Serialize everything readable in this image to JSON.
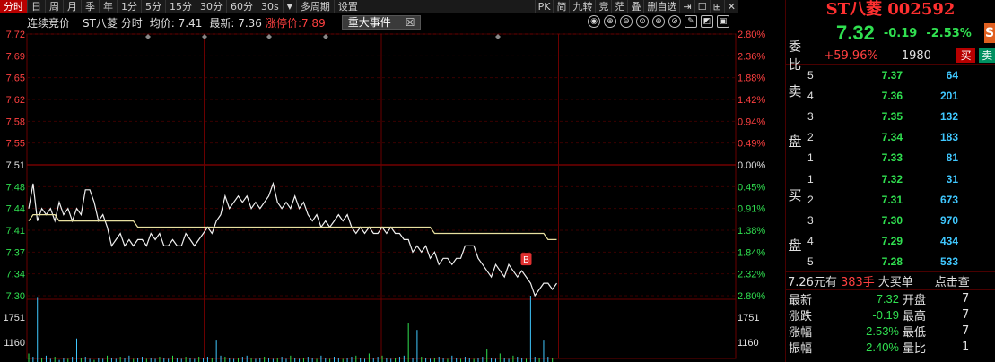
{
  "toolbar": {
    "periods": [
      "分时",
      "日",
      "周",
      "月",
      "季",
      "年",
      "1分",
      "5分",
      "15分",
      "30分",
      "60分",
      "30s",
      "多周期",
      "设置"
    ],
    "active_index": 0,
    "dropdown_arrow": "▼",
    "right_items": [
      "PK",
      "简",
      "九转",
      "竞",
      "茫",
      "叠",
      "删自选",
      "⇥",
      "☐",
      "⊞",
      "✕"
    ]
  },
  "infobar": {
    "continuous_label": "连续竞价",
    "stock_name": "ST八菱 分时",
    "avg_price": "均价: 7.41",
    "latest": "最新: 7.36",
    "limit_up": "涨停价:7.89",
    "event_tag": "重大事件",
    "event_close": "☒",
    "icons": [
      "◉",
      "⊕",
      "⊖",
      "⊙",
      "⊕",
      "⊘",
      "✎",
      "◩",
      "▣"
    ]
  },
  "chart_data": {
    "type": "line",
    "title": "ST八菱 分时",
    "prev_close": 7.51,
    "ylim": [
      7.3,
      7.72
    ],
    "y_ticks": [
      "7.72",
      "7.69",
      "7.65",
      "7.62",
      "7.58",
      "7.55",
      "7.51",
      "7.48",
      "7.44",
      "7.41",
      "7.37",
      "7.34",
      "7.30"
    ],
    "pct_ticks": [
      "2.80%",
      "2.36%",
      "1.88%",
      "1.42%",
      "0.94%",
      "0.49%",
      "0.00%",
      "0.45%",
      "0.91%",
      "1.38%",
      "1.84%",
      "2.32%",
      "2.80%"
    ],
    "volume_ticks": [
      "1751",
      "1160"
    ],
    "series": [
      {
        "values": [
          7.44,
          7.48,
          7.42,
          7.44,
          7.43,
          7.44,
          7.42,
          7.45,
          7.43,
          7.44,
          7.42,
          7.44,
          7.43,
          7.47,
          7.47,
          7.45,
          7.42,
          7.43,
          7.41,
          7.38,
          7.39,
          7.4,
          7.38,
          7.39,
          7.38,
          7.39,
          7.39,
          7.38,
          7.4,
          7.39,
          7.4,
          7.38,
          7.38,
          7.39,
          7.38,
          7.38,
          7.4,
          7.39,
          7.38,
          7.39,
          7.4,
          7.41,
          7.4,
          7.42,
          7.43,
          7.46,
          7.44,
          7.45,
          7.46,
          7.45,
          7.46,
          7.44,
          7.45,
          7.44,
          7.45,
          7.46,
          7.48,
          7.45,
          7.44,
          7.45,
          7.44,
          7.46,
          7.44,
          7.45,
          7.43,
          7.42,
          7.43,
          7.41,
          7.42,
          7.41,
          7.42,
          7.43,
          7.42,
          7.43,
          7.41,
          7.4,
          7.41,
          7.4,
          7.41,
          7.4,
          7.4,
          7.41,
          7.4,
          7.41,
          7.4,
          7.4,
          7.39,
          7.39,
          7.37,
          7.38,
          7.37,
          7.38,
          7.36,
          7.37,
          7.35,
          7.36,
          7.36,
          7.35,
          7.36,
          7.36,
          7.38,
          7.38,
          7.38,
          7.36,
          7.35,
          7.34,
          7.33,
          7.35,
          7.34,
          7.33,
          7.35,
          7.34,
          7.33,
          7.34,
          7.33,
          7.32,
          7.3,
          7.31,
          7.32,
          7.32,
          7.31,
          7.32
        ]
      },
      {
        "values": [
          7.42,
          7.43,
          7.43,
          7.43,
          7.43,
          7.43,
          7.43,
          7.42,
          7.42,
          7.42,
          7.42,
          7.42,
          7.42,
          7.42,
          7.42,
          7.42,
          7.42,
          7.42,
          7.42,
          7.42,
          7.42,
          7.42,
          7.42,
          7.42,
          7.42,
          7.41,
          7.41,
          7.41,
          7.41,
          7.41,
          7.41,
          7.41,
          7.41,
          7.41,
          7.41,
          7.41,
          7.41,
          7.41,
          7.41,
          7.41,
          7.41,
          7.41,
          7.41,
          7.41,
          7.41,
          7.41,
          7.41,
          7.41,
          7.41,
          7.41,
          7.41,
          7.41,
          7.41,
          7.41,
          7.41,
          7.41,
          7.41,
          7.41,
          7.41,
          7.41,
          7.41,
          7.41,
          7.41,
          7.41,
          7.41,
          7.41,
          7.41,
          7.41,
          7.41,
          7.41,
          7.41,
          7.41,
          7.41,
          7.41,
          7.41,
          7.41,
          7.41,
          7.41,
          7.41,
          7.41,
          7.41,
          7.41,
          7.41,
          7.41,
          7.41,
          7.41,
          7.41,
          7.41,
          7.41,
          7.41,
          7.41,
          7.41,
          7.41,
          7.4,
          7.4,
          7.4,
          7.4,
          7.4,
          7.4,
          7.4,
          7.4,
          7.4,
          7.4,
          7.4,
          7.4,
          7.4,
          7.4,
          7.4,
          7.4,
          7.4,
          7.4,
          7.4,
          7.4,
          7.4,
          7.4,
          7.4,
          7.4,
          7.4,
          7.4,
          7.39,
          7.39,
          7.39
        ]
      }
    ],
    "volume": [
      8,
      5,
      60,
      4,
      6,
      3,
      5,
      2,
      4,
      3,
      5,
      22,
      4,
      5,
      3,
      2,
      4,
      3,
      6,
      4,
      3,
      5,
      4,
      6,
      3,
      4,
      5,
      3,
      4,
      3,
      5,
      4,
      3,
      6,
      4,
      3,
      5,
      4,
      3,
      5,
      4,
      5,
      4,
      20,
      6,
      5,
      4,
      3,
      4,
      5,
      6,
      4,
      3,
      4,
      5,
      4,
      3,
      4,
      5,
      3,
      6,
      4,
      3,
      4,
      5,
      4,
      3,
      6,
      4,
      3,
      5,
      4,
      3,
      4,
      5,
      6,
      4,
      3,
      8,
      4,
      5,
      6,
      4,
      3,
      4,
      5,
      6,
      36,
      4,
      30,
      5,
      4,
      3,
      4,
      5,
      4,
      3,
      6,
      4,
      3,
      5,
      4,
      3,
      4,
      5,
      12,
      4,
      3,
      8,
      4,
      3,
      6,
      5,
      4,
      3,
      62,
      5,
      4,
      20,
      5,
      4
    ]
  },
  "chart_marker": "B",
  "panel": {
    "title": "ST八菱 002592",
    "price": "7.32",
    "change": "-0.19",
    "change_pct": "-2.53%",
    "logo": "S",
    "weibi_label": "委比",
    "weibi_val": "+59.96%",
    "weibi_num": "1980",
    "buy_label": "买",
    "sell_label": "卖",
    "sell_side_label": "卖盘",
    "buy_side_label": "买盘",
    "asks": [
      {
        "idx": "5",
        "price": "7.37",
        "vol": "64"
      },
      {
        "idx": "4",
        "price": "7.36",
        "vol": "201"
      },
      {
        "idx": "3",
        "price": "7.35",
        "vol": "132"
      },
      {
        "idx": "2",
        "price": "7.34",
        "vol": "183"
      },
      {
        "idx": "1",
        "price": "7.33",
        "vol": "81"
      }
    ],
    "bids": [
      {
        "idx": "1",
        "price": "7.32",
        "vol": "31"
      },
      {
        "idx": "2",
        "price": "7.31",
        "vol": "673"
      },
      {
        "idx": "3",
        "price": "7.30",
        "vol": "970"
      },
      {
        "idx": "4",
        "price": "7.29",
        "vol": "434"
      },
      {
        "idx": "5",
        "price": "7.28",
        "vol": "533"
      }
    ],
    "trade": {
      "price": "7.26元有",
      "vol": "383手",
      "type": "大买单",
      "link": "点击查"
    },
    "stats": [
      {
        "l1": "最新",
        "v1": "7.32",
        "c1": "green",
        "l2": "开盘",
        "v2": "7"
      },
      {
        "l1": "涨跌",
        "v1": "-0.19",
        "c1": "green",
        "l2": "最高",
        "v2": "7"
      },
      {
        "l1": "涨幅",
        "v1": "-2.53%",
        "c1": "green",
        "l2": "最低",
        "v2": "7"
      },
      {
        "l1": "振幅",
        "v1": "2.40%",
        "c1": "green",
        "l2": "量比",
        "v2": "1"
      }
    ]
  }
}
